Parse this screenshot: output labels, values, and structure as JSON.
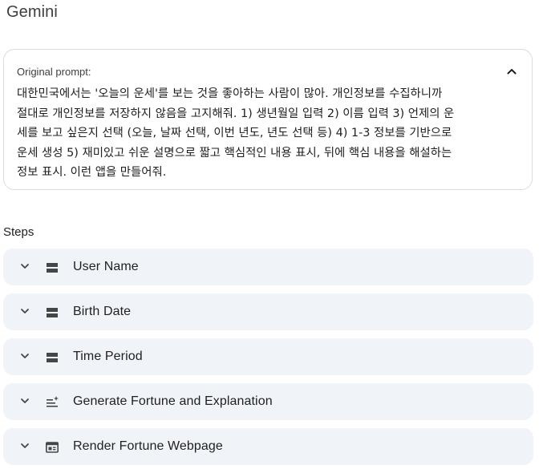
{
  "app": {
    "title": "Gemini"
  },
  "prompt": {
    "label": "Original prompt:",
    "text": "대한민국에서는 '오늘의 운세'를 보는 것을 좋아하는 사람이 많아. 개인정보를 수집하니까\n절대로 개인정보를 저장하지 않음을 고지해줘. 1) 생년월일 입력 2) 이름 입력 3) 언제의 운\n세를 보고 싶은지 선택 (오늘, 날짜 선택, 이번 년도, 년도 선택 등) 4) 1-3 정보를 기반으로\n운세 생성 5) 재미있고 쉬운 설명으로 짧고 핵심적인 내용 표시, 뒤에 핵심 내용을 해설하는\n정보 표시. 이런 앱을 만들어줘.",
    "collapse_icon": "chevron-up-icon"
  },
  "steps": {
    "label": "Steps",
    "items": [
      {
        "label": "User Name",
        "icon": "input-field-icon"
      },
      {
        "label": "Birth Date",
        "icon": "input-field-icon"
      },
      {
        "label": "Time Period",
        "icon": "input-field-icon"
      },
      {
        "label": "Generate Fortune and Explanation",
        "icon": "text-sparkle-icon"
      },
      {
        "label": "Render Fortune Webpage",
        "icon": "web-page-icon"
      }
    ]
  },
  "colors": {
    "step_background": "#f0f4f9",
    "card_border": "#dadce0",
    "icon": "#444746"
  }
}
